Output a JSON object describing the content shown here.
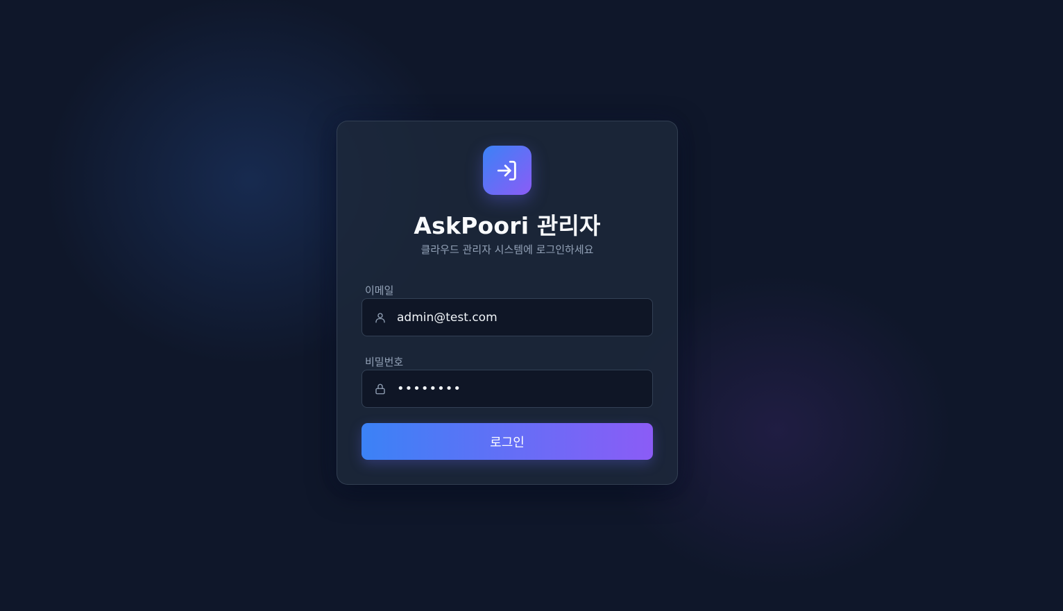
{
  "header": {
    "title": "AskPoori 관리자",
    "subtitle": "클라우드 관리자 시스템에 로그인하세요"
  },
  "form": {
    "email_label": "이메일",
    "email_value": "admin@test.com",
    "password_label": "비밀번호",
    "password_value": "••••••••",
    "submit_label": "로그인"
  },
  "icons": {
    "logo": "login-arrow-icon",
    "email": "user-icon",
    "password": "lock-icon"
  },
  "colors": {
    "background": "#0f172a",
    "card": "#1e293b",
    "accent_start": "#3b82f6",
    "accent_end": "#8b5cf6",
    "text_primary": "#f8fafc",
    "text_muted": "#94a3b8"
  }
}
